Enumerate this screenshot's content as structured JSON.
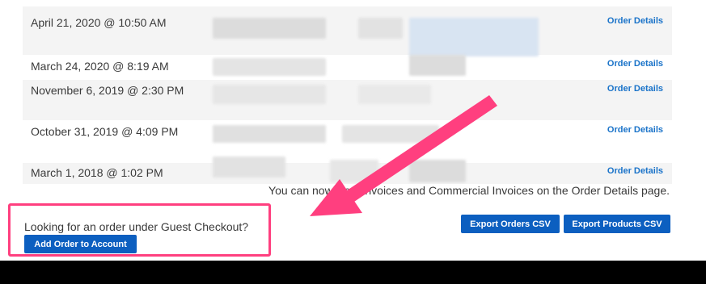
{
  "orders": [
    {
      "date": "April 21, 2020 @ 10:50 AM",
      "link": "Order Details"
    },
    {
      "date": "March 24, 2020 @ 8:19 AM",
      "link": "Order Details"
    },
    {
      "date": "November 6, 2019 @ 2:30 PM",
      "link": "Order Details"
    },
    {
      "date": "October 31, 2019 @ 4:09 PM",
      "link": "Order Details"
    },
    {
      "date": "March 1, 2018 @ 1:02 PM",
      "link": "Order Details"
    }
  ],
  "notice": "You can now view Invoices and Commercial Invoices on the Order Details page.",
  "guest": {
    "prompt": "Looking for an order under Guest Checkout?",
    "button": "Add Order to Account"
  },
  "export": {
    "orders_button": "Export Orders CSV",
    "products_button": "Export Products CSV"
  },
  "colors": {
    "accent": "#0c5fc0",
    "link": "#1a73c9",
    "highlight": "#ff3f7f"
  }
}
